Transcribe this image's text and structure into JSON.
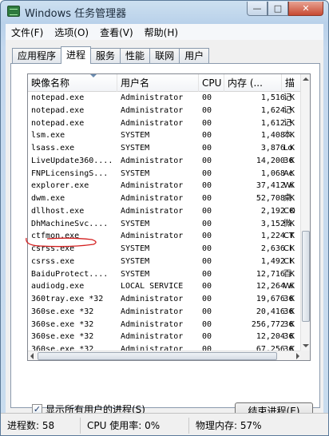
{
  "window": {
    "title": "Windows 任务管理器",
    "controls": {
      "minimize": "—",
      "maximize": "□",
      "close": "✕"
    }
  },
  "menu": [
    "文件(F)",
    "选项(O)",
    "查看(V)",
    "帮助(H)"
  ],
  "tabs": [
    {
      "label": "应用程序",
      "active": false
    },
    {
      "label": "进程",
      "active": true
    },
    {
      "label": "服务",
      "active": false
    },
    {
      "label": "性能",
      "active": false
    },
    {
      "label": "联网",
      "active": false
    },
    {
      "label": "用户",
      "active": false
    }
  ],
  "columns": {
    "image": "映像名称",
    "user": "用户名",
    "cpu": "CPU",
    "memory": "内存 (...",
    "desc": "描"
  },
  "processes": [
    {
      "image": "notepad.exe",
      "user": "Administrator",
      "cpu": "00",
      "memory": "1,516 K",
      "desc": "记"
    },
    {
      "image": "notepad.exe",
      "user": "Administrator",
      "cpu": "00",
      "memory": "1,624 K",
      "desc": "记"
    },
    {
      "image": "notepad.exe",
      "user": "Administrator",
      "cpu": "00",
      "memory": "1,612 K",
      "desc": "记"
    },
    {
      "image": "lsm.exe",
      "user": "SYSTEM",
      "cpu": "00",
      "memory": "1,408 K",
      "desc": "本"
    },
    {
      "image": "lsass.exe",
      "user": "SYSTEM",
      "cpu": "00",
      "memory": "3,876 K",
      "desc": "Lo"
    },
    {
      "image": "LiveUpdate360....",
      "user": "Administrator",
      "cpu": "00",
      "memory": "14,200 K",
      "desc": "36"
    },
    {
      "image": "FNPLicensingS...",
      "user": "SYSTEM",
      "cpu": "00",
      "memory": "1,068 K",
      "desc": "Ac"
    },
    {
      "image": "explorer.exe",
      "user": "Administrator",
      "cpu": "00",
      "memory": "37,412 K",
      "desc": "Wi"
    },
    {
      "image": "dwm.exe",
      "user": "Administrator",
      "cpu": "00",
      "memory": "52,708 K",
      "desc": "桌"
    },
    {
      "image": "dllhost.exe",
      "user": "Administrator",
      "cpu": "00",
      "memory": "2,192 K",
      "desc": "CO"
    },
    {
      "image": "DhMachineSvc....",
      "user": "SYSTEM",
      "cpu": "00",
      "memory": "3,152 K",
      "desc": "微"
    },
    {
      "image": "ctfmon.exe",
      "user": "Administrator",
      "cpu": "00",
      "memory": "1,224 K",
      "desc": "CT"
    },
    {
      "image": "csrss.exe",
      "user": "SYSTEM",
      "cpu": "00",
      "memory": "2,636 K",
      "desc": "Cl"
    },
    {
      "image": "csrss.exe",
      "user": "SYSTEM",
      "cpu": "00",
      "memory": "1,492 K",
      "desc": "Cl"
    },
    {
      "image": "BaiduProtect....",
      "user": "SYSTEM",
      "cpu": "00",
      "memory": "12,716 K",
      "desc": "百"
    },
    {
      "image": "audiodg.exe",
      "user": "LOCAL SERVICE",
      "cpu": "00",
      "memory": "12,264 K",
      "desc": "Wi"
    },
    {
      "image": "360tray.exe *32",
      "user": "Administrator",
      "cpu": "00",
      "memory": "19,676 K",
      "desc": "36"
    },
    {
      "image": "360se.exe *32",
      "user": "Administrator",
      "cpu": "00",
      "memory": "20,416 K",
      "desc": "36"
    },
    {
      "image": "360se.exe *32",
      "user": "Administrator",
      "cpu": "00",
      "memory": "256,772 K",
      "desc": "36"
    },
    {
      "image": "360se.exe *32",
      "user": "Administrator",
      "cpu": "00",
      "memory": "12,204 K",
      "desc": "36"
    },
    {
      "image": "360se.exe *32",
      "user": "Administrator",
      "cpu": "00",
      "memory": "67,256 K",
      "desc": "36"
    }
  ],
  "show_all_users": {
    "label": "显示所有用户的进程(S)",
    "checked": true
  },
  "end_process_button": "结束进程(E)",
  "status": {
    "processes": "进程数: 58",
    "cpu": "CPU 使用率: 0%",
    "memory": "物理内存: 57%"
  },
  "colors": {
    "annotation": "#d42020"
  }
}
